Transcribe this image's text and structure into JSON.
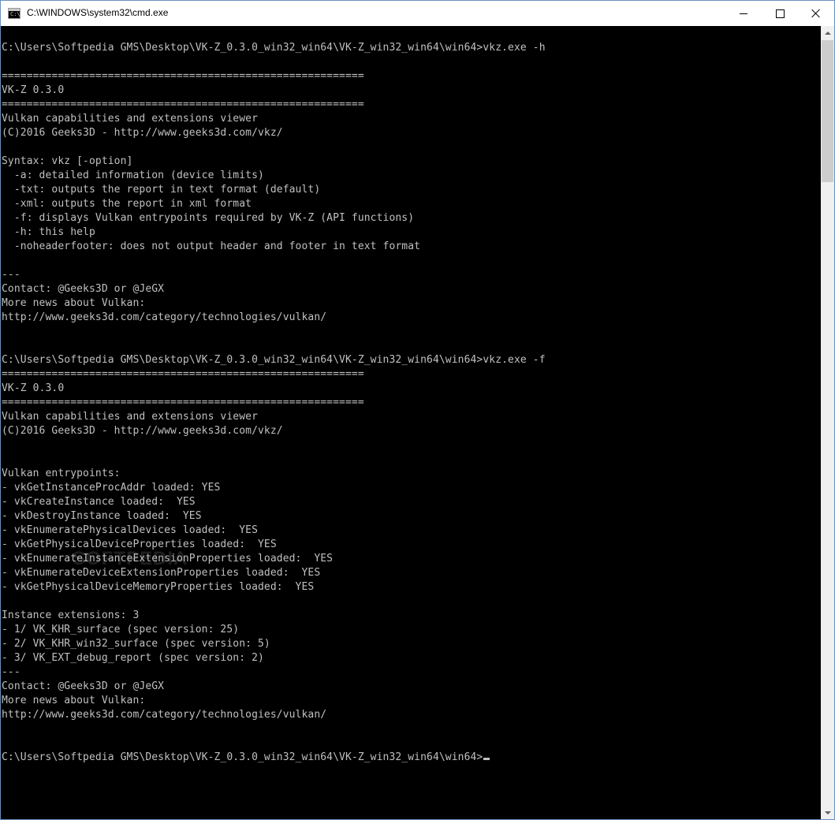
{
  "window": {
    "title": "C:\\WINDOWS\\system32\\cmd.exe",
    "icon_text": "C:\\_",
    "icon": "cmd-icon",
    "minimize_icon": "minimize-icon",
    "maximize_icon": "maximize-icon",
    "close_icon": "close-icon"
  },
  "colors": {
    "console_bg": "#000000",
    "console_text": "#c0c0c0",
    "titlebar_bg": "#ffffff"
  },
  "console": {
    "lines": [
      "C:\\Users\\Softpedia GMS\\Desktop\\VK-Z_0.3.0_win32_win64\\VK-Z_win32_win64\\win64>vkz.exe -h",
      "",
      "==========================================================",
      "VK-Z 0.3.0",
      "==========================================================",
      "Vulkan capabilities and extensions viewer",
      "(C)2016 Geeks3D - http://www.geeks3d.com/vkz/",
      "",
      "Syntax: vkz [-option]",
      "  -a: detailed information (device limits)",
      "  -txt: outputs the report in text format (default)",
      "  -xml: outputs the report in xml format",
      "  -f: displays Vulkan entrypoints required by VK-Z (API functions)",
      "  -h: this help",
      "  -noheaderfooter: does not output header and footer in text format",
      "",
      "---",
      "Contact: @Geeks3D or @JeGX",
      "More news about Vulkan:",
      "http://www.geeks3d.com/category/technologies/vulkan/",
      "",
      "",
      "C:\\Users\\Softpedia GMS\\Desktop\\VK-Z_0.3.0_win32_win64\\VK-Z_win32_win64\\win64>vkz.exe -f",
      "==========================================================",
      "VK-Z 0.3.0",
      "==========================================================",
      "Vulkan capabilities and extensions viewer",
      "(C)2016 Geeks3D - http://www.geeks3d.com/vkz/",
      "",
      "",
      "Vulkan entrypoints:",
      "- vkGetInstanceProcAddr loaded: YES",
      "- vkCreateInstance loaded:  YES",
      "- vkDestroyInstance loaded:  YES",
      "- vkEnumeratePhysicalDevices loaded:  YES",
      "- vkGetPhysicalDeviceProperties loaded:  YES",
      "- vkEnumerateInstanceExtensionProperties loaded:  YES",
      "- vkEnumerateDeviceExtensionProperties loaded:  YES",
      "- vkGetPhysicalDeviceMemoryProperties loaded:  YES",
      "",
      "Instance extensions: 3",
      "- 1/ VK_KHR_surface (spec version: 25)",
      "- 2/ VK_KHR_win32_surface (spec version: 5)",
      "- 3/ VK_EXT_debug_report (spec version: 2)",
      "---",
      "Contact: @Geeks3D or @JeGX",
      "More news about Vulkan:",
      "http://www.geeks3d.com/category/technologies/vulkan/",
      "",
      "",
      "C:\\Users\\Softpedia GMS\\Desktop\\VK-Z_0.3.0_win32_win64\\VK-Z_win32_win64\\win64>"
    ],
    "watermark": "SOFTPEDIA"
  },
  "scrollbar": {
    "up_icon": "scroll-up-arrow-icon",
    "down_icon": "scroll-down-arrow-icon"
  }
}
